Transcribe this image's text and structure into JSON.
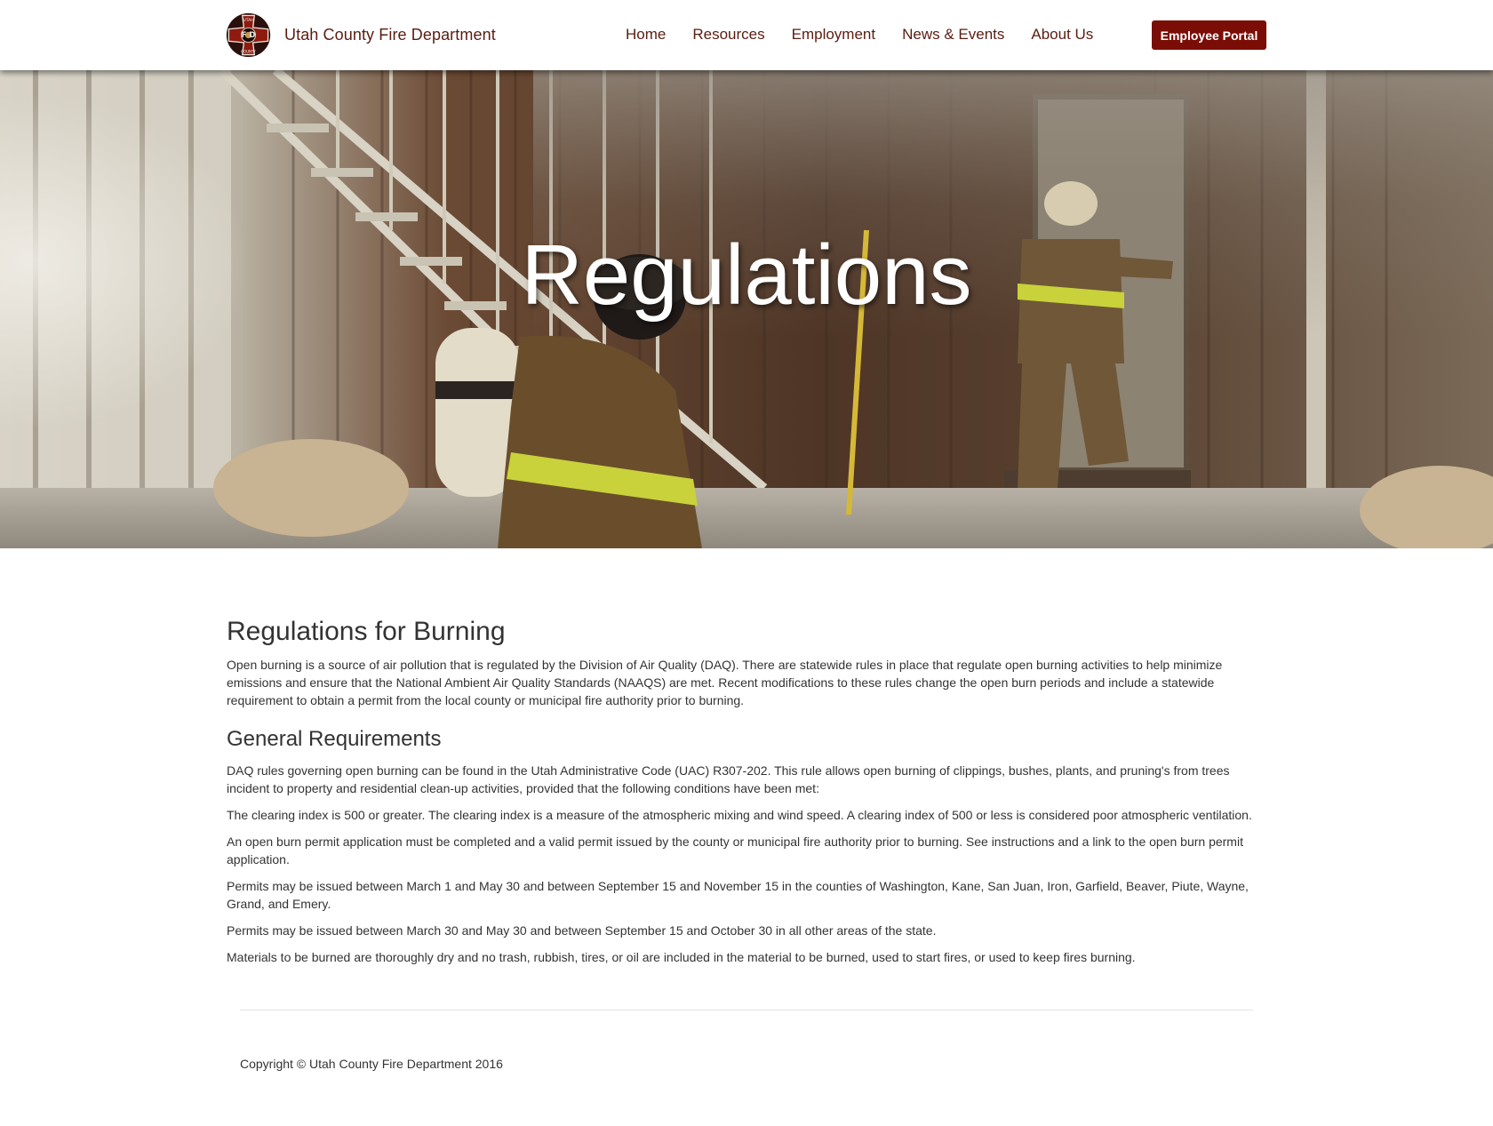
{
  "brand": {
    "name": "Utah County Fire Department",
    "logo_text_top": "UTAH",
    "logo_text_mid": "F D",
    "logo_text_bottom": "COUNTY"
  },
  "nav": {
    "items": [
      {
        "label": "Home"
      },
      {
        "label": "Resources"
      },
      {
        "label": "Employment"
      },
      {
        "label": "News & Events"
      },
      {
        "label": "About Us"
      }
    ],
    "portal_label": "Employee Portal"
  },
  "hero": {
    "title": "Regulations",
    "image": "firefighters-training-photo"
  },
  "content": {
    "heading": "Regulations for Burning",
    "intro": "Open burning is a source of air pollution that is regulated by the Division of Air Quality (DAQ). There are statewide rules in place that regulate open burning activities to help minimize emissions and ensure that the National Ambient Air Quality Standards (NAAQS) are met. Recent modifications to these rules change the open burn periods and include a statewide requirement to obtain a permit from the local county or municipal fire authority prior to burning.",
    "subheading": "General Requirements",
    "paragraphs": [
      "DAQ rules governing open burning can be found in the Utah Administrative Code (UAC) R307-202. This rule allows open burning of clippings, bushes, plants, and pruning's from trees incident to property and residential clean-up activities, provided that the following conditions have been met:",
      "The clearing index is 500 or greater. The clearing index is a measure of the atmospheric mixing and wind speed. A clearing index of 500 or less is considered poor atmospheric ventilation.",
      "An open burn permit application must be completed and a valid permit issued by the county or municipal fire authority prior to burning. See instructions and a link to the open burn permit application.",
      "Permits may be issued between March 1 and May 30 and between September 15 and November 15 in the counties of Washington, Kane, San Juan, Iron, Garfield, Beaver, Piute, Wayne, Grand, and Emery.",
      "Permits may be issued between March 30 and May 30 and between September 15 and October 30 in all other areas of the state.",
      "Materials to be burned are thoroughly dry and no trash, rubbish, tires, or oil are included in the material to be burned, used to start fires, or used to keep fires burning."
    ]
  },
  "footer": {
    "copyright": "Copyright © Utah County Fire Department 2016"
  },
  "colors": {
    "brand_text": "#5a1d12",
    "portal_button": "#7a0e06",
    "body_text": "#333333"
  }
}
